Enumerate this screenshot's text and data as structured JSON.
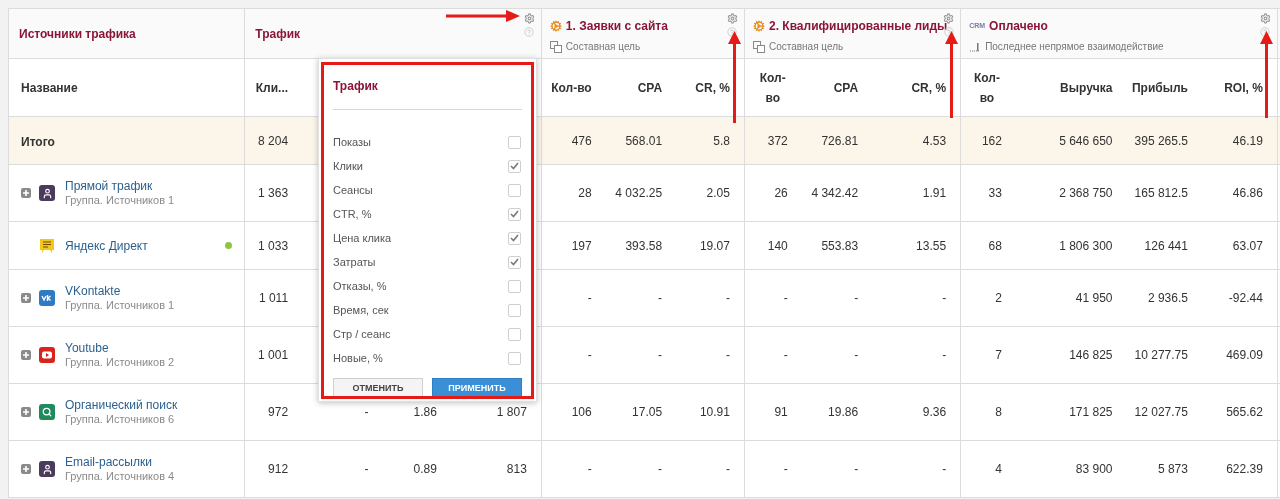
{
  "groups": [
    {
      "kind": "names",
      "title": "Источники трафика",
      "columns": [
        "Название"
      ]
    },
    {
      "kind": "traffic",
      "title": "Трафик",
      "columns": [
        "Кли..."
      ]
    },
    {
      "kind": "goal",
      "title": "1. Заявки с сайта",
      "subtitle": "Составная цель",
      "columns": [
        "Кол-во",
        "CPA",
        "CR, %"
      ]
    },
    {
      "kind": "goal",
      "title": "2. Квалифицированные лиды",
      "subtitle": "Составная цель",
      "columns": [
        "Кол-во",
        "CPA",
        "CR, %"
      ]
    },
    {
      "kind": "crm",
      "badge": "CRM",
      "title": "Оплачено",
      "subtitle": "Последнее непрямое взаимодействие",
      "columns": [
        "Кол-во",
        "Выручка",
        "Прибыль",
        "ROI, %"
      ]
    }
  ],
  "rows": [
    {
      "kind": "total",
      "name": "Итого",
      "cells": [
        [
          "8 204"
        ],
        [
          "476",
          "568.01",
          "5.8"
        ],
        [
          "372",
          "726.81",
          "4.53"
        ],
        [
          "162",
          "5 646 650",
          "395 265.5",
          "46.19"
        ]
      ]
    },
    {
      "kind": "group",
      "name": "Прямой трафик",
      "subtitle": "Группа. Источников 1",
      "cells": [
        [
          "1 363"
        ],
        [
          "28",
          "4 032.25",
          "2.05"
        ],
        [
          "26",
          "4 342.42",
          "1.91"
        ],
        [
          "33",
          "2 368 750",
          "165 812.5",
          "46.86"
        ]
      ]
    },
    {
      "kind": "source",
      "name": "Яндекс Директ",
      "color": "#8dc63f",
      "cells": [
        [
          "1 033"
        ],
        [
          "197",
          "393.58",
          "19.07"
        ],
        [
          "140",
          "553.83",
          "13.55"
        ],
        [
          "68",
          "1 806 300",
          "126 441",
          "63.07"
        ]
      ]
    },
    {
      "kind": "group",
      "name": "VKontakte",
      "subtitle": "Группа. Источников 1",
      "cells": [
        [
          "1 011"
        ],
        [
          "-",
          "-",
          "-"
        ],
        [
          "-",
          "-",
          "-"
        ],
        [
          "2",
          "41 950",
          "2 936.5",
          "-92.44"
        ]
      ]
    },
    {
      "kind": "group",
      "name": "Youtube",
      "subtitle": "Группа. Источников 2",
      "cells": [
        [
          "1 001"
        ],
        [
          "-",
          "-",
          "-"
        ],
        [
          "-",
          "-",
          "-"
        ],
        [
          "7",
          "146 825",
          "10 277.75",
          "469.09"
        ]
      ]
    },
    {
      "kind": "group",
      "name": "Органический поиск",
      "subtitle": "Группа. Источников 6",
      "cells": [
        [
          "972",
          "-",
          "1.86",
          "1 807"
        ],
        [
          "106",
          "17.05",
          "10.91"
        ],
        [
          "91",
          "19.86",
          "9.36"
        ],
        [
          "8",
          "171 825",
          "12 027.75",
          "565.62"
        ]
      ]
    },
    {
      "kind": "group",
      "name": "Email-рассылки",
      "subtitle": "Группа. Источников 4",
      "cells": [
        [
          "912",
          "-",
          "0.89",
          "813"
        ],
        [
          "-",
          "-",
          "-"
        ],
        [
          "-",
          "-",
          "-"
        ],
        [
          "4",
          "83 900",
          "5 873",
          "622.39"
        ]
      ]
    }
  ],
  "popup": {
    "title": "Трафик",
    "options": [
      {
        "label": "Показы",
        "checked": false
      },
      {
        "label": "Клики",
        "checked": true
      },
      {
        "label": "Сеансы",
        "checked": false
      },
      {
        "label": "CTR, %",
        "checked": true
      },
      {
        "label": "Цена клика",
        "checked": true
      },
      {
        "label": "Затраты",
        "checked": true
      },
      {
        "label": "Отказы, %",
        "checked": false
      },
      {
        "label": "Время, сек",
        "checked": false
      },
      {
        "label": "Стр / сеанс",
        "checked": false
      },
      {
        "label": "Новые, %",
        "checked": false
      }
    ],
    "buttons": [
      {
        "kind": "cancel",
        "label": "ОТМЕНИТЬ"
      },
      {
        "kind": "apply",
        "label": "ПРИМЕНИТЬ"
      }
    ]
  }
}
